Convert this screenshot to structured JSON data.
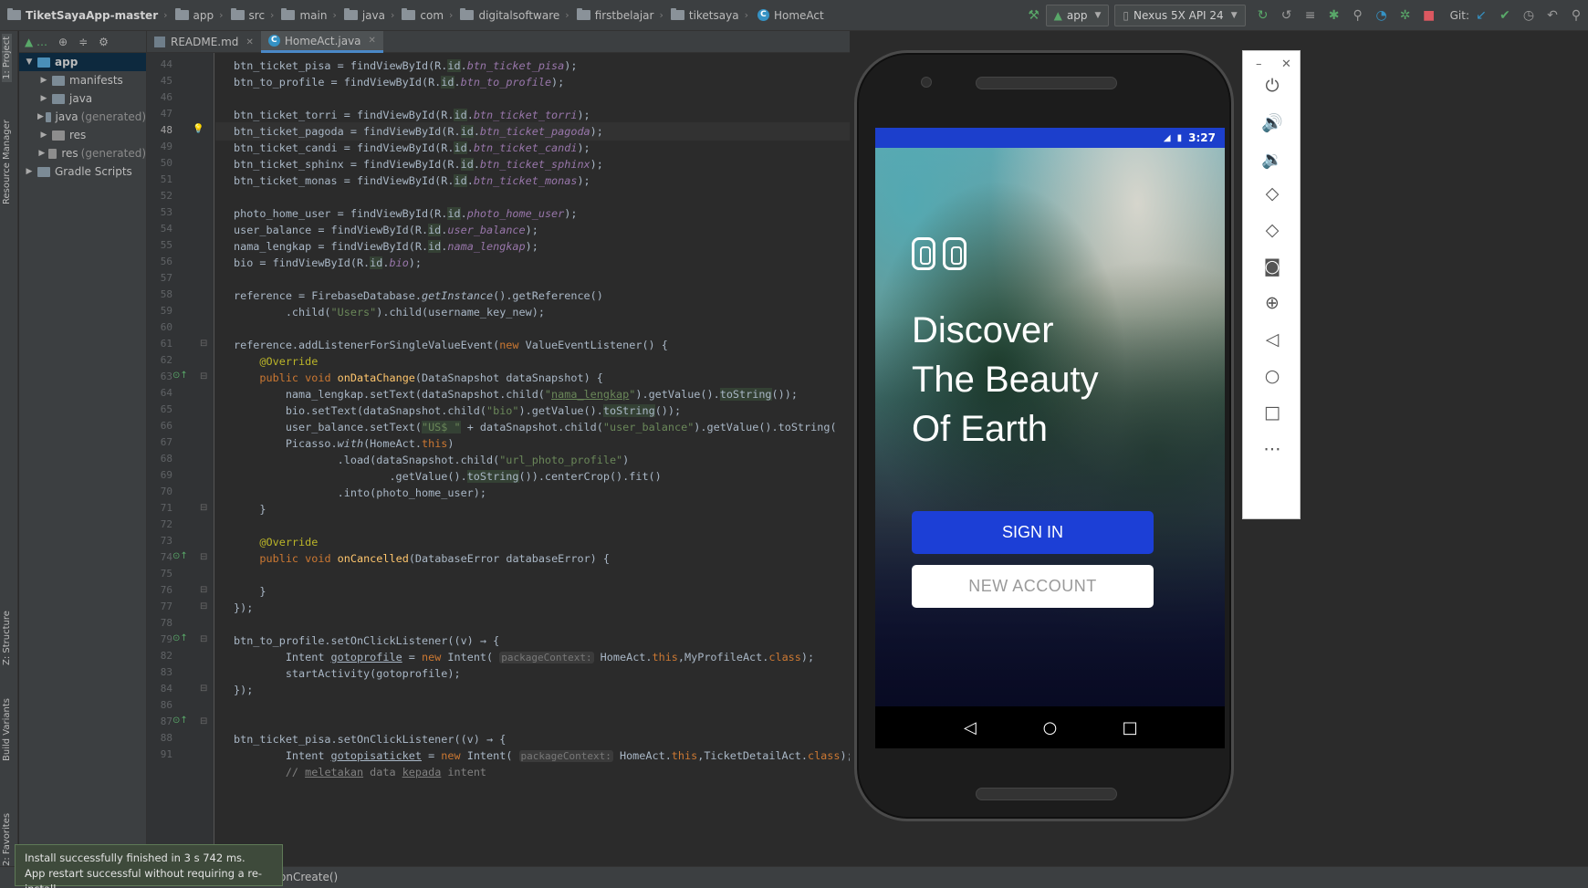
{
  "breadcrumbs": [
    "TiketSayaApp-master",
    "app",
    "src",
    "main",
    "java",
    "com",
    "digitalsoftware",
    "firstbelajar",
    "tiketsaya",
    "HomeAct"
  ],
  "run_config": {
    "module": "app",
    "device": "Nexus 5X API 24",
    "git_label": "Git:"
  },
  "left_strip": {
    "project": "1: Project",
    "resource_manager": "Resource Manager",
    "structure": "Z: Structure",
    "build_variants": "Build Variants",
    "favorites": "2: Favorites"
  },
  "project_tree": [
    {
      "label": "app",
      "suffix": "",
      "level": 0,
      "expanded": true,
      "selected": true,
      "icon": "module-icon"
    },
    {
      "label": "manifests",
      "suffix": "",
      "level": 1,
      "expanded": false,
      "selected": false,
      "icon": "folder-icon"
    },
    {
      "label": "java",
      "suffix": "",
      "level": 1,
      "expanded": false,
      "selected": false,
      "icon": "folder-icon"
    },
    {
      "label": "java",
      "suffix": "(generated)",
      "level": 1,
      "expanded": false,
      "selected": false,
      "icon": "folder-icon"
    },
    {
      "label": "res",
      "suffix": "",
      "level": 1,
      "expanded": false,
      "selected": false,
      "icon": "folder-icon"
    },
    {
      "label": "res",
      "suffix": "(generated)",
      "level": 1,
      "expanded": false,
      "selected": false,
      "icon": "folder-icon"
    },
    {
      "label": "Gradle Scripts",
      "suffix": "",
      "level": 0,
      "expanded": false,
      "selected": false,
      "icon": "gradle-icon"
    }
  ],
  "tabs": [
    {
      "label": "README.md",
      "active": false
    },
    {
      "label": "HomeAct.java",
      "active": true
    }
  ],
  "code_lines": [
    {
      "n": "44",
      "html": "btn_ticket_pisa = findViewById(R.<span class=\"hl\">id</span>.<span class=\"fld\">btn_ticket_pisa</span>);"
    },
    {
      "n": "45",
      "html": "btn_to_profile = findViewById(R.<span class=\"hl\">id</span>.<span class=\"fld\">btn_to_profile</span>);"
    },
    {
      "n": "46",
      "html": ""
    },
    {
      "n": "47",
      "html": "btn_ticket_torri = findViewById(R.<span class=\"hl\">id</span>.<span class=\"fld\">btn_ticket_torri</span>);"
    },
    {
      "n": "48",
      "html": "btn_ticket_pagoda = findViewById(R.<span class=\"hl\">id</span>.<span class=\"fld\">btn_ticket_pagoda</span>);",
      "current": true
    },
    {
      "n": "49",
      "html": "btn_ticket_candi = findViewById(R.<span class=\"hl\">id</span>.<span class=\"fld\">btn_ticket_candi</span>);"
    },
    {
      "n": "50",
      "html": "btn_ticket_sphinx = findViewById(R.<span class=\"hl\">id</span>.<span class=\"fld\">btn_ticket_sphinx</span>);"
    },
    {
      "n": "51",
      "html": "btn_ticket_monas = findViewById(R.<span class=\"hl\">id</span>.<span class=\"fld\">btn_ticket_monas</span>);"
    },
    {
      "n": "52",
      "html": ""
    },
    {
      "n": "53",
      "html": "photo_home_user = findViewById(R.<span class=\"hl\">id</span>.<span class=\"fld\">photo_home_user</span>);"
    },
    {
      "n": "54",
      "html": "user_balance = findViewById(R.<span class=\"hl\">id</span>.<span class=\"fld\">user_balance</span>);"
    },
    {
      "n": "55",
      "html": "nama_lengkap = findViewById(R.<span class=\"hl\">id</span>.<span class=\"fld\">nama_lengkap</span>);"
    },
    {
      "n": "56",
      "html": "bio = findViewById(R.<span class=\"hl\">id</span>.<span class=\"fld\">bio</span>);"
    },
    {
      "n": "57",
      "html": ""
    },
    {
      "n": "58",
      "html": "reference = FirebaseDatabase.<i>getInstance</i>().getReference()"
    },
    {
      "n": "59",
      "html": "        .child(<span class=\"str\">\"Users\"</span>).child(username_key_new);"
    },
    {
      "n": "60",
      "html": ""
    },
    {
      "n": "61",
      "html": "reference.addListenerForSingleValueEvent(<span class=\"kw\">new</span> ValueEventListener() {"
    },
    {
      "n": "62",
      "html": "    <span class=\"ann\">@Override</span>"
    },
    {
      "n": "63",
      "html": "    <span class=\"kw\">public void</span> <span class=\"mth\">onDataChange</span>(DataSnapshot dataSnapshot) {"
    },
    {
      "n": "64",
      "html": "        nama_lengkap.setText(dataSnapshot.child(<span class=\"str\">\"<u>nama_lengkap</u>\"</span>).getValue().<span class=\"hl\">toString</span>());"
    },
    {
      "n": "65",
      "html": "        bio.setText(dataSnapshot.child(<span class=\"str\">\"bio\"</span>).getValue().<span class=\"hl\">toString</span>());"
    },
    {
      "n": "66",
      "html": "        user_balance.setText(<span class=\"str hl\">\"US$ \"</span> + dataSnapshot.child(<span class=\"str\">\"user_balance\"</span>).getValue().toString("
    },
    {
      "n": "67",
      "html": "        Picasso.<i>with</i>(HomeAct.<span class=\"kw\">this</span>)"
    },
    {
      "n": "68",
      "html": "                .load(dataSnapshot.child(<span class=\"str\">\"url_photo_profile\"</span>)"
    },
    {
      "n": "69",
      "html": "                        .getValue().<span class=\"hl\">toString</span>()).centerCrop().fit()"
    },
    {
      "n": "70",
      "html": "                .into(photo_home_user);"
    },
    {
      "n": "71",
      "html": "    }"
    },
    {
      "n": "72",
      "html": ""
    },
    {
      "n": "73",
      "html": "    <span class=\"ann\">@Override</span>"
    },
    {
      "n": "74",
      "html": "    <span class=\"kw\">public void</span> <span class=\"mth\">onCancelled</span>(DatabaseError databaseError) {"
    },
    {
      "n": "75",
      "html": ""
    },
    {
      "n": "76",
      "html": "    }"
    },
    {
      "n": "77",
      "html": "});"
    },
    {
      "n": "78",
      "html": ""
    },
    {
      "n": "79",
      "html": "btn_to_profile.setOnClickListener((v) → {"
    },
    {
      "n": "82",
      "html": "        Intent <u>gotoprofile</u> = <span class=\"kw\">new</span> Intent( <span class=\"hint\">packageContext:</span> HomeAct.<span class=\"kw\">this</span>,MyProfileAct.<span class=\"kw\">class</span>);"
    },
    {
      "n": "83",
      "html": "        startActivity(gotoprofile);"
    },
    {
      "n": "84",
      "html": "});"
    },
    {
      "n": "86",
      "html": ""
    },
    {
      "n": "87",
      "html": ""
    },
    {
      "n": "88",
      "html": "btn_ticket_pisa.setOnClickListener((v) → {"
    },
    {
      "n": "91",
      "html": "        Intent <u>gotopisaticket</u> = <span class=\"kw\">new</span> Intent( <span class=\"hint\">packageContext:</span> HomeAct.<span class=\"kw\">this</span>,TicketDetailAct.<span class=\"kw\">class</span>);"
    },
    {
      "n": "",
      "html": "        <span style=\"color:#808080\">// <u>meletakan</u> data <u>kepada</u> intent</span>"
    }
  ],
  "status_bar": {
    "method_crumb": "onCreate()"
  },
  "notification": {
    "line1": "Install successfully finished in 3 s 742 ms.",
    "line2": "App restart successful without requiring a re-install."
  },
  "emulator": {
    "clock": "3:27",
    "headline_line1": "Discover",
    "headline_line2": "The Beauty",
    "headline_line3": "Of Earth",
    "signin_label": "SIGN IN",
    "new_account_label": "NEW ACCOUNT",
    "accent": "#1c3fd6"
  },
  "emulator_tools": [
    "power-icon",
    "volume-up-icon",
    "volume-down-icon",
    "rotate-left-icon",
    "rotate-right-icon",
    "screenshot-icon",
    "zoom-icon",
    "back-icon",
    "home-icon",
    "overview-icon",
    "more-icon"
  ]
}
